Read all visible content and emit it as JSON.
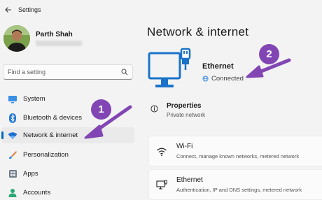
{
  "window": {
    "app_title": "Settings"
  },
  "user": {
    "name": "Parth Shah"
  },
  "search": {
    "placeholder": "Find a setting"
  },
  "sidebar": {
    "items": [
      {
        "label": "System",
        "icon": "monitor-icon",
        "active": false
      },
      {
        "label": "Bluetooth & devices",
        "icon": "bluetooth-icon",
        "active": false
      },
      {
        "label": "Network & internet",
        "icon": "wifi-icon",
        "active": true
      },
      {
        "label": "Personalization",
        "icon": "brush-icon",
        "active": false
      },
      {
        "label": "Apps",
        "icon": "apps-icon",
        "active": false
      },
      {
        "label": "Accounts",
        "icon": "person-icon",
        "active": false
      }
    ]
  },
  "main": {
    "title": "Network & internet",
    "ethernet": {
      "title": "Ethernet",
      "status": "Connected"
    },
    "properties": {
      "title": "Properties",
      "subtitle": "Private network"
    },
    "cards": [
      {
        "title": "Wi-Fi",
        "subtitle": "Connect, manage known networks, metered network",
        "icon": "wifi-icon"
      },
      {
        "title": "Ethernet",
        "subtitle": "Authentication, IP and DNS settings, metered network",
        "icon": "ethernet-icon"
      }
    ]
  },
  "annotations": {
    "badge_1": "1",
    "badge_2": "2"
  },
  "colors": {
    "accent": "#0067c0",
    "annotation": "#8246b4",
    "background": "#f3f3f3"
  }
}
